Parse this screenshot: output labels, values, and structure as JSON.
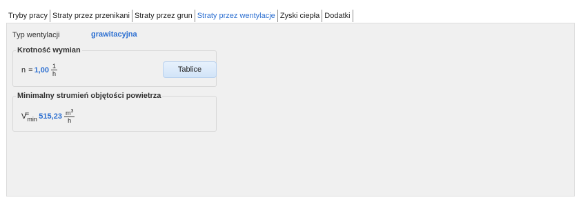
{
  "tabs": [
    {
      "label": "Tryby pracy",
      "active": false
    },
    {
      "label": "Straty przez przenikani",
      "active": false
    },
    {
      "label": "Straty przez grun",
      "active": false
    },
    {
      "label": "Straty przez wentylacje",
      "active": true
    },
    {
      "label": "Zyski ciepła",
      "active": false
    },
    {
      "label": "Dodatki",
      "active": false
    }
  ],
  "ventilation": {
    "label": "Typ wentylacji",
    "value": "grawitacyjna"
  },
  "exchange_group": {
    "title": "Krotność wymian",
    "symbol": "n",
    "equals": "=",
    "value": "1,00",
    "unit_num": "1",
    "unit_den": "h",
    "button_label": "Tablice"
  },
  "flow_group": {
    "title": "Minimalny strumień objętości powietrza",
    "symbol": "V",
    "subscript": "min",
    "equals": "=",
    "value": "515,23",
    "unit_num": "m3",
    "unit_den": "h"
  },
  "colors": {
    "accent": "#2c6fd1",
    "panel_bg": "#f0f0f0",
    "button_bg": "#dbe9fa"
  }
}
